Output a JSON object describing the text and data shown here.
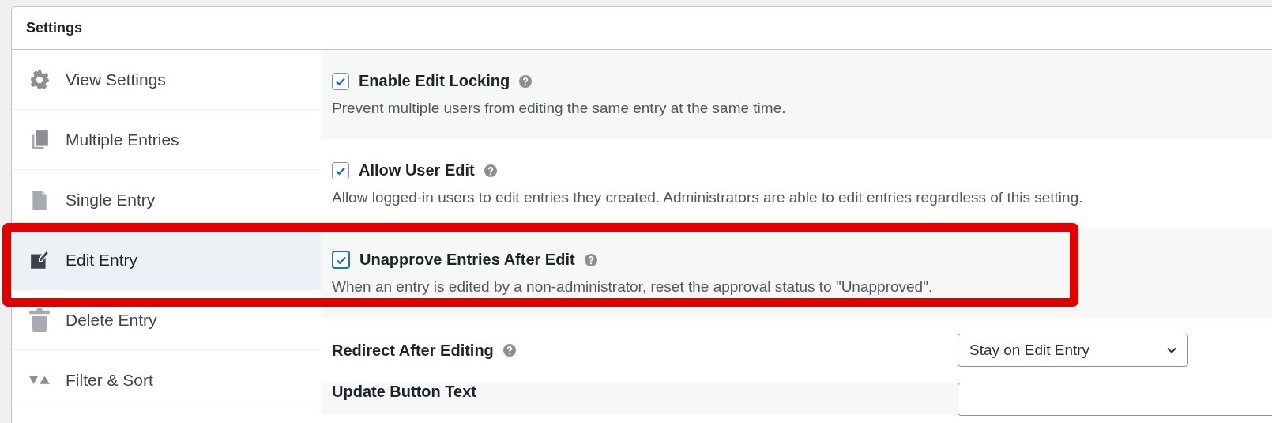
{
  "panel": {
    "title": "Settings"
  },
  "sidebar": {
    "items": [
      {
        "label": "View Settings",
        "selected": false
      },
      {
        "label": "Multiple Entries",
        "selected": false
      },
      {
        "label": "Single Entry",
        "selected": false
      },
      {
        "label": "Edit Entry",
        "selected": true
      },
      {
        "label": "Delete Entry",
        "selected": false
      },
      {
        "label": "Filter & Sort",
        "selected": false
      }
    ]
  },
  "settings": [
    {
      "kind": "checkbox",
      "label": "Enable Edit Locking",
      "checked": true,
      "highlighted": false,
      "description": "Prevent multiple users from editing the same entry at the same time."
    },
    {
      "kind": "checkbox",
      "label": "Allow User Edit",
      "checked": true,
      "highlighted": false,
      "description": "Allow logged-in users to edit entries they created. Administrators are able to edit entries regardless of this setting."
    },
    {
      "kind": "checkbox",
      "label": "Unapprove Entries After Edit",
      "checked": true,
      "highlighted": true,
      "description": "When an entry is edited by a non-administrator, reset the approval status to \"Unapproved\"."
    },
    {
      "kind": "select",
      "label": "Redirect After Editing",
      "value": "Stay on Edit Entry"
    },
    {
      "kind": "text",
      "label": "Update Button Text"
    }
  ]
}
